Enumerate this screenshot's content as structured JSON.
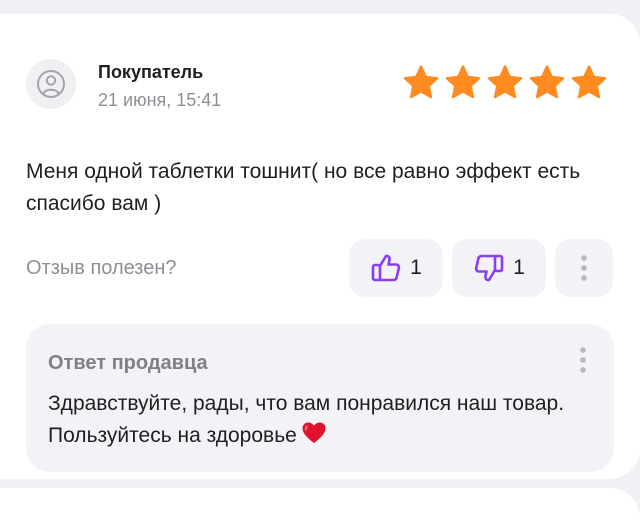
{
  "review": {
    "author": "Покупатель",
    "date": "21 июня, 15:41",
    "rating": 5,
    "rating_max": 5,
    "text": "Меня одной таблетки тошнит( но все равно эффект есть спасибо вам )",
    "helpful_label": "Отзыв полезен?",
    "likes": "1",
    "dislikes": "1"
  },
  "seller_reply": {
    "title": "Ответ продавца",
    "text": "Здравствуйте, рады, что вам понравился наш товар. Пользуйтесь на здоровье"
  },
  "icons": {
    "avatar": "user-avatar-icon",
    "star": "star-icon",
    "like": "thumbs-up-icon",
    "dislike": "thumbs-down-icon",
    "more": "more-vertical-icon",
    "heart": "red-heart-emoji"
  },
  "colors": {
    "star": "#ff8a1f",
    "like_icon": "#8b3df5",
    "muted_text": "#8e8e95",
    "heart": "#e0122b"
  }
}
